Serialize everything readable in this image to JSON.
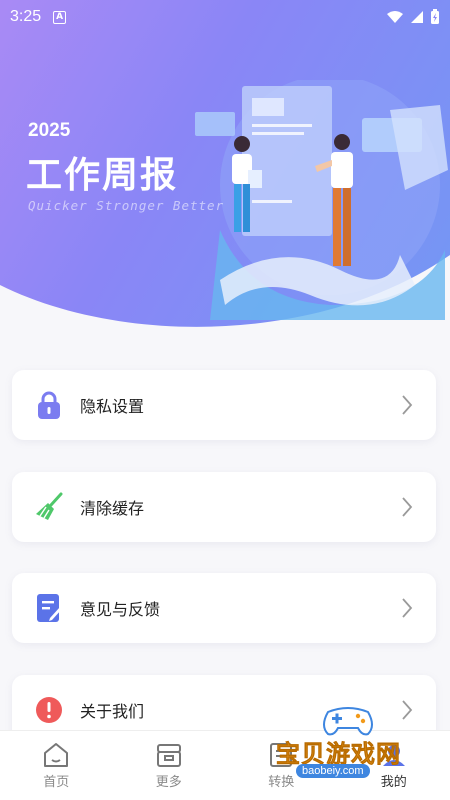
{
  "status_bar": {
    "time": "3:25",
    "notification_glyph": "A"
  },
  "hero": {
    "year": "2025",
    "title": "工作周报",
    "subtitle": "Quicker Stronger Better"
  },
  "menu": [
    {
      "label": "隐私设置",
      "icon": "lock-icon",
      "color": "#7b7cf0"
    },
    {
      "label": "清除缓存",
      "icon": "broom-icon",
      "color": "#4fc86a"
    },
    {
      "label": "意见与反馈",
      "icon": "edit-note-icon",
      "color": "#5b73e8"
    },
    {
      "label": "关于我们",
      "icon": "info-icon",
      "color": "#ef5a5a"
    }
  ],
  "tabs": [
    {
      "label": "首页",
      "icon": "home-icon",
      "active": false
    },
    {
      "label": "更多",
      "icon": "grid-box-icon",
      "active": false
    },
    {
      "label": "转换",
      "icon": "document-icon",
      "active": false
    },
    {
      "label": "我的",
      "icon": "user-icon",
      "active": true
    }
  ],
  "watermark": {
    "text": "宝贝游戏网",
    "url": "baobeiy.com"
  },
  "colors": {
    "hero_start": "#a98af5",
    "hero_end": "#7398f4",
    "background": "#f7f7fa"
  }
}
